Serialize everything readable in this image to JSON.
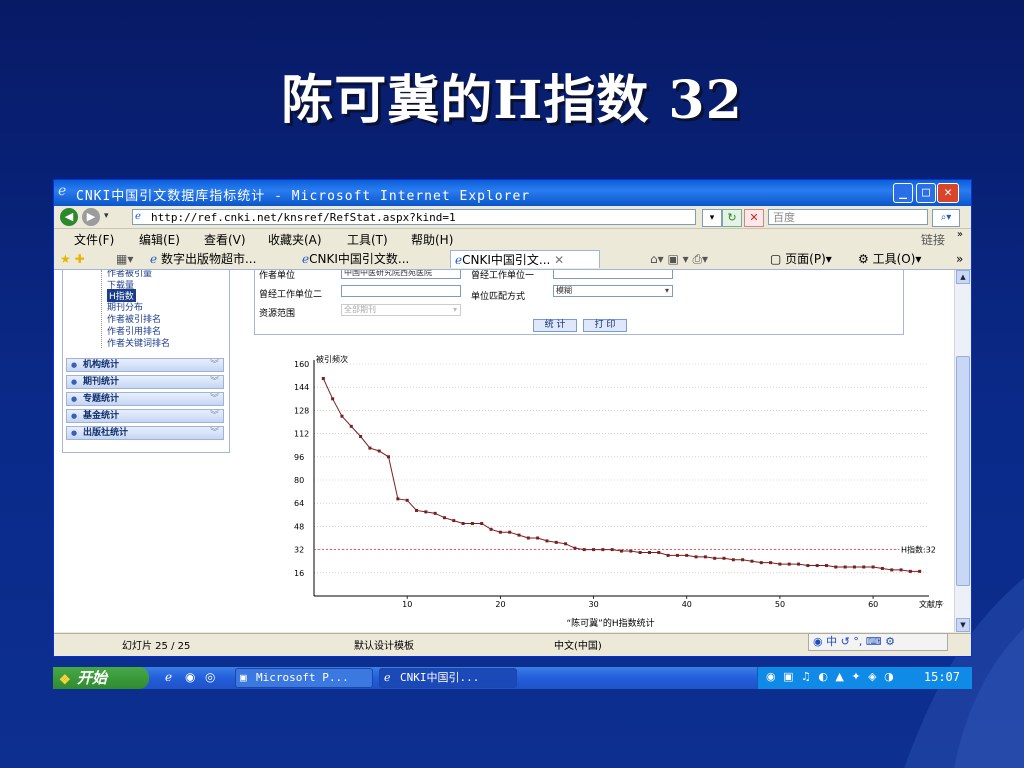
{
  "slide": {
    "title": "陈可冀的H指数  32"
  },
  "browser": {
    "window_title": "CNKI中国引文数据库指标统计 - Microsoft Internet Explorer",
    "address": "http://ref.cnki.net/knsref/RefStat.aspx?kind=1",
    "search_placeholder": "百度",
    "menu": [
      "文件(F)",
      "编辑(E)",
      "查看(V)",
      "收藏夹(A)",
      "工具(T)",
      "帮助(H)"
    ],
    "links_label": "链接",
    "tabs": [
      "数字出版物超市...",
      "CNKI中国引文数...",
      "CNKI中国引文..."
    ],
    "toolbar_right": [
      "页面(P)",
      "工具(O)"
    ],
    "status": {
      "pages": "幻灯片 25 / 25",
      "template": "默认设计模板",
      "lang": "中文(中国)"
    }
  },
  "sidebar": {
    "tree": [
      "作者被引量",
      "下载量",
      "H指数",
      "期刊分布",
      "作者被引排名",
      "作者引用排名",
      "作者关键词排名"
    ],
    "selected_index": 2,
    "categories": [
      "机构统计",
      "期刊统计",
      "专题统计",
      "基金统计",
      "出版社统计"
    ]
  },
  "form": {
    "author_unit_label": "作者单位",
    "author_unit_value": "中国中医研究院西苑医院",
    "former_unit1_label": "曾经工作单位一",
    "former_unit2_label": "曾经工作单位二",
    "match_label": "单位匹配方式",
    "match_value": "模糊",
    "scope_label": "资源范围",
    "scope_value": "全部期刊",
    "stat_button": "统 计",
    "print_button": "打 印"
  },
  "chart_data": {
    "type": "line",
    "title": "“陈可冀”的H指数统计",
    "ylabel": "被引频次",
    "xlabel": "文献序号",
    "ylim": [
      0,
      160
    ],
    "xlim": [
      0,
      66
    ],
    "yticks": [
      16,
      32,
      48,
      64,
      80,
      96,
      112,
      128,
      144,
      160
    ],
    "xticks": [
      10,
      20,
      30,
      40,
      50,
      60
    ],
    "h_index_label": "H指数:32",
    "h_index": 32,
    "x": [
      1,
      2,
      3,
      4,
      5,
      6,
      7,
      8,
      9,
      10,
      11,
      12,
      13,
      14,
      15,
      16,
      17,
      18,
      19,
      20,
      21,
      22,
      23,
      24,
      25,
      26,
      27,
      28,
      29,
      30,
      31,
      32,
      33,
      34,
      35,
      36,
      37,
      38,
      39,
      40,
      41,
      42,
      43,
      44,
      45,
      46,
      47,
      48,
      49,
      50,
      51,
      52,
      53,
      54,
      55,
      56,
      57,
      58,
      59,
      60,
      61,
      62,
      63,
      64,
      65
    ],
    "values": [
      150,
      136,
      124,
      117,
      110,
      102,
      100,
      96,
      67,
      66,
      59,
      58,
      57,
      54,
      52,
      50,
      50,
      50,
      46,
      44,
      44,
      42,
      40,
      40,
      38,
      37,
      36,
      33,
      32,
      32,
      32,
      32,
      31,
      31,
      30,
      30,
      30,
      28,
      28,
      28,
      27,
      27,
      26,
      26,
      25,
      25,
      24,
      23,
      23,
      22,
      22,
      22,
      21,
      21,
      21,
      20,
      20,
      20,
      20,
      20,
      19,
      18,
      18,
      17,
      17
    ]
  },
  "taskbar": {
    "start": "开始",
    "tasks": [
      "Microsoft P...",
      "CNKI中国引..."
    ],
    "clock": "15:07"
  },
  "colors": {
    "line": "#7a1f1f",
    "hline": "#d23b3b",
    "grid": "#b8b8b8"
  }
}
